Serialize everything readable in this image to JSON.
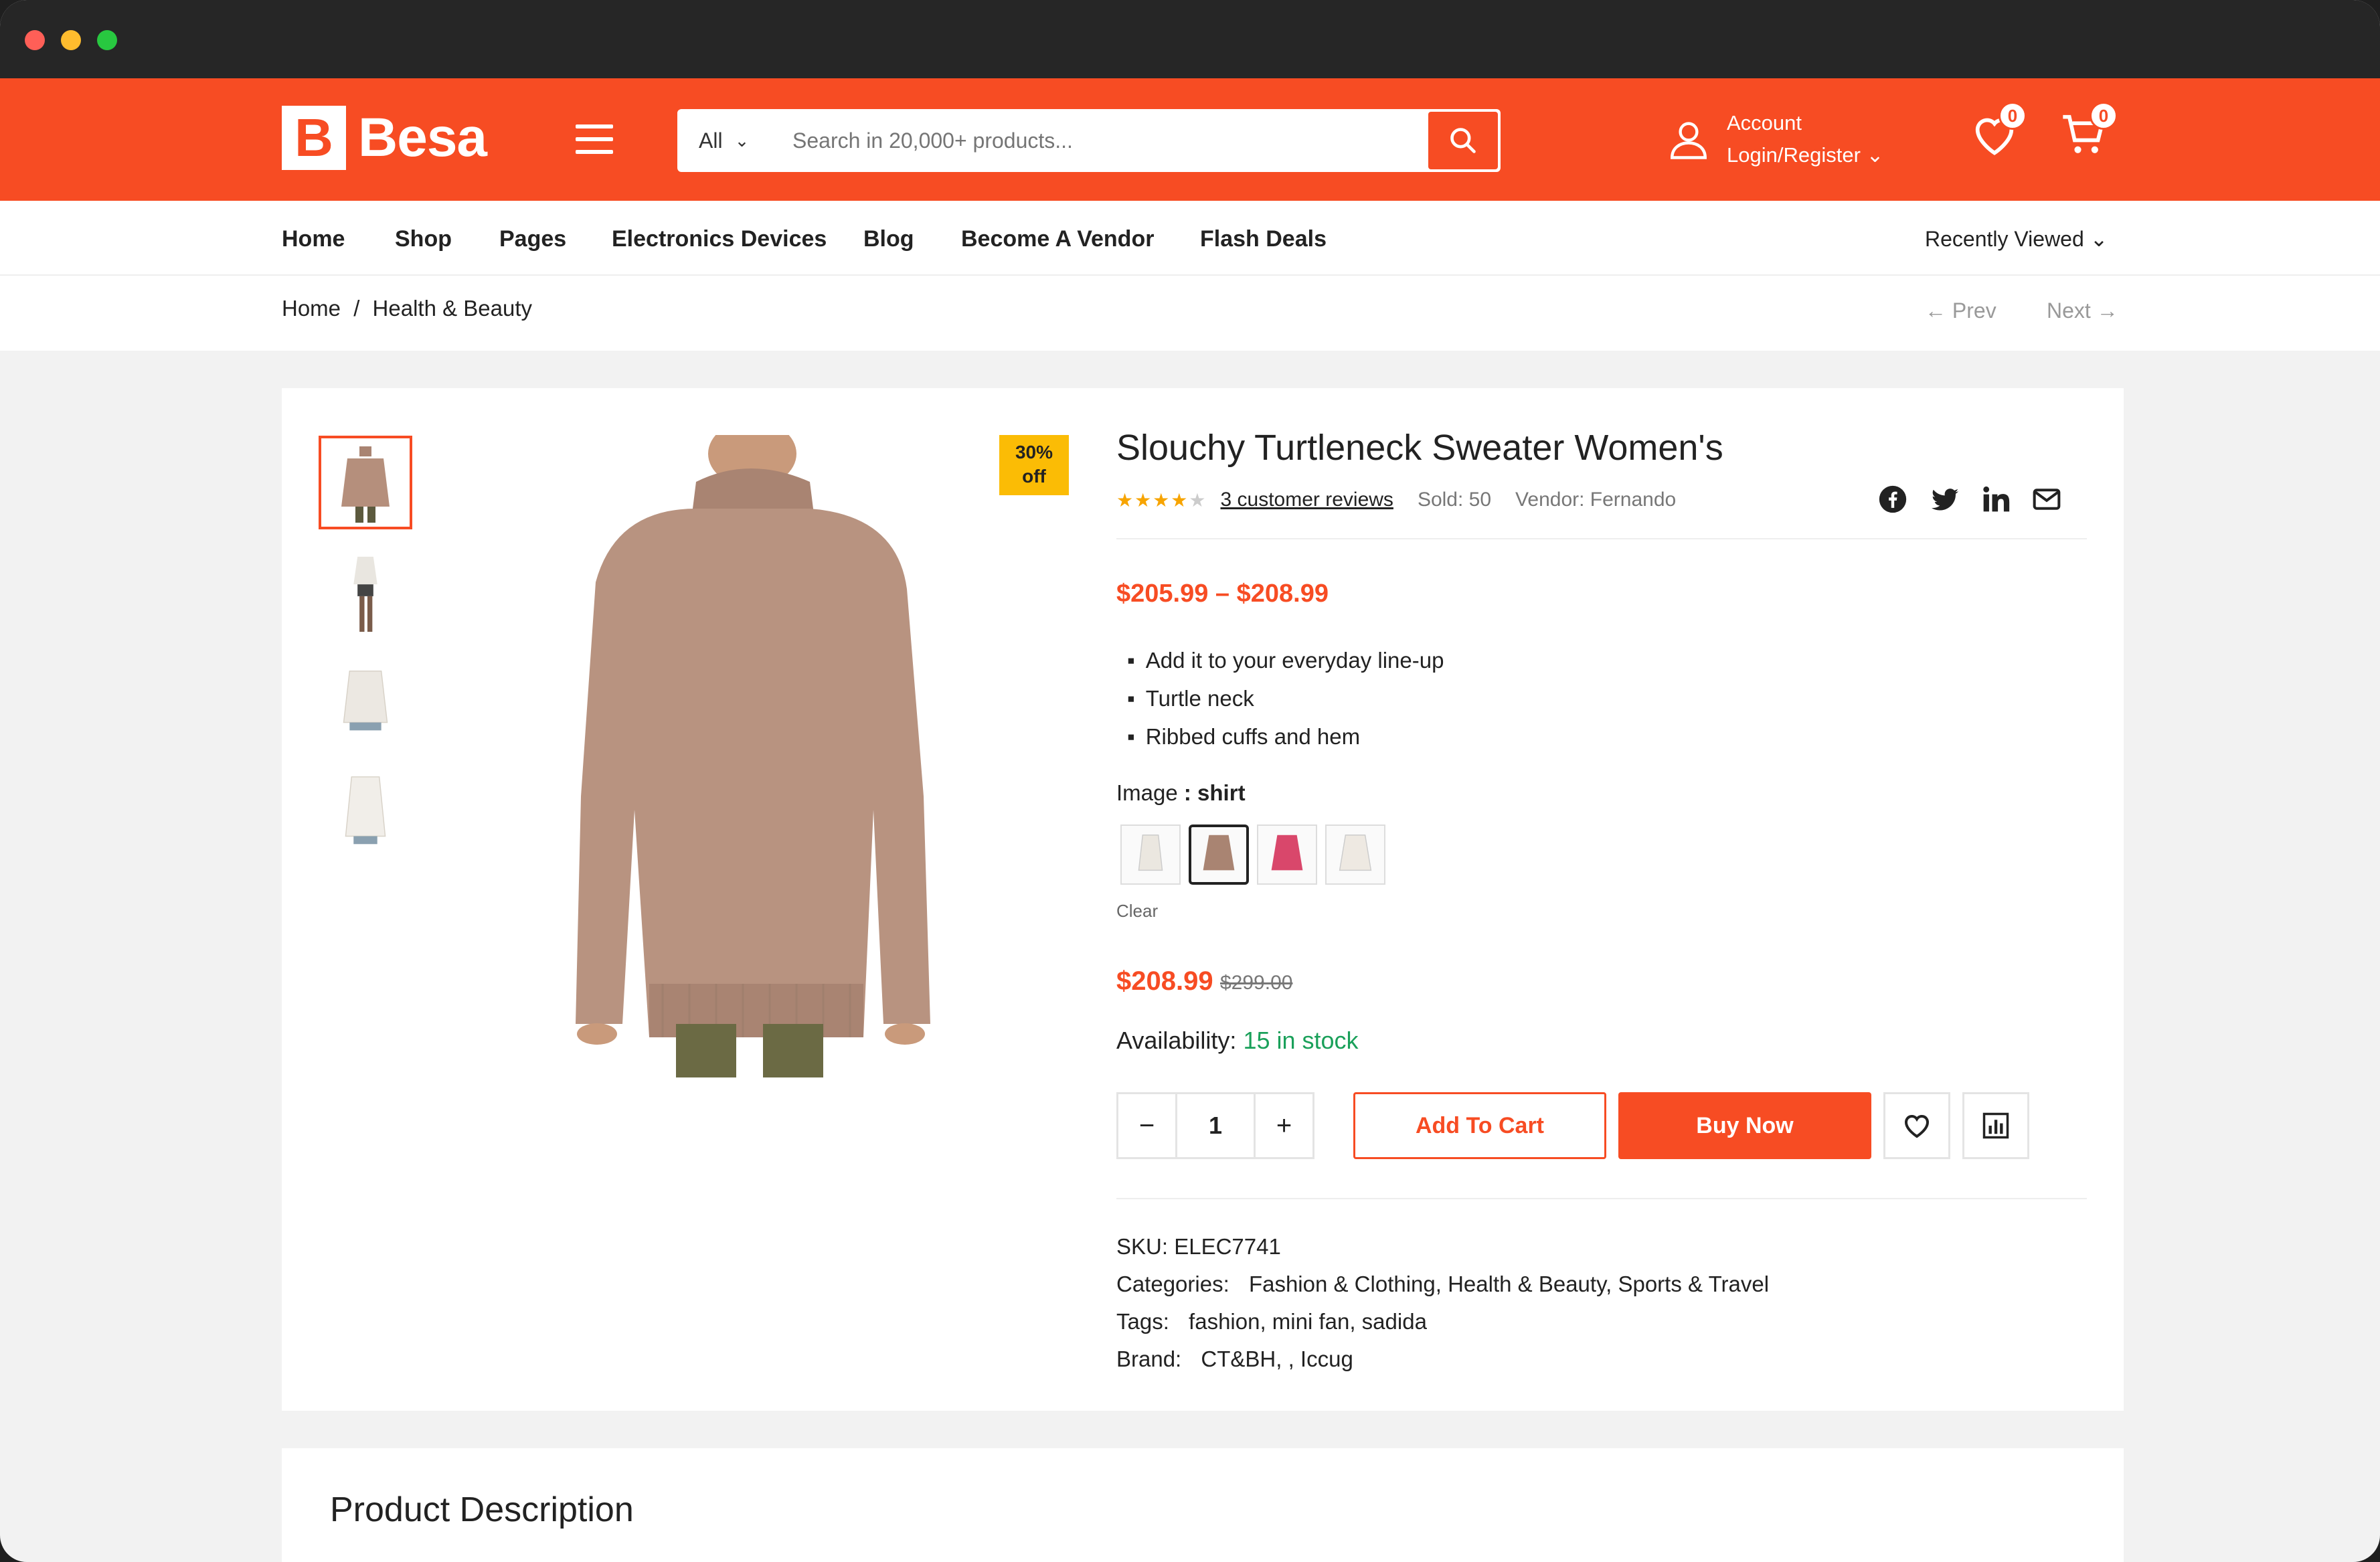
{
  "colors": {
    "accent": "#f74c23",
    "stock": "#1aa05a",
    "star": "#f7a400",
    "badge": "#fbbc05"
  },
  "header": {
    "logo_letter": "B",
    "logo_text": "Besa",
    "search": {
      "category": "All",
      "placeholder": "Search in 20,000+ products..."
    },
    "account": {
      "line1": "Account",
      "line2": "Login/Register"
    },
    "wishlist_count": "0",
    "cart_count": "0"
  },
  "nav": {
    "items": [
      "Home",
      "Shop",
      "Pages",
      "Electronics Devices",
      "Blog",
      "Become A Vendor",
      "Flash Deals"
    ],
    "recently_viewed": "Recently Viewed"
  },
  "breadcrumb": {
    "home": "Home",
    "separator": "/",
    "current": "Health & Beauty",
    "prev": "Prev",
    "next": "Next"
  },
  "product": {
    "discount_line1": "30%",
    "discount_line2": "off",
    "title": "Slouchy Turtleneck Sweater Women's",
    "rating_stars": 4,
    "reviews": "3 customer reviews",
    "sold": "Sold: 50",
    "vendor": "Vendor: Fernando",
    "price_range": "$205.99 – $208.99",
    "bullets": [
      "Add it to your everyday line-up",
      "Turtle neck",
      "Ribbed cuffs and hem"
    ],
    "variation_label": "Image",
    "variation_value": "shirt",
    "clear": "Clear",
    "price_now": "$208.99",
    "price_old": "$299.00",
    "availability_label": "Availability:",
    "availability_value": "15 in stock",
    "quantity": "1",
    "minus": "−",
    "plus": "+",
    "add_to_cart": "Add To Cart",
    "buy_now": "Buy Now",
    "sku_label": "SKU:",
    "sku": "ELEC7741",
    "categories_label": "Categories:",
    "categories": "Fashion & Clothing, Health & Beauty, Sports & Travel",
    "tags_label": "Tags:",
    "tags": "fashion, mini fan, sadida",
    "brand_label": "Brand:",
    "brand": "CT&BH, , Iccug"
  },
  "description": {
    "title": "Product Description"
  },
  "icons": [
    "menu-icon",
    "search-icon",
    "user-icon",
    "heart-icon",
    "cart-icon",
    "facebook-icon",
    "twitter-icon",
    "linkedin-icon",
    "mail-icon",
    "compare-icon"
  ]
}
